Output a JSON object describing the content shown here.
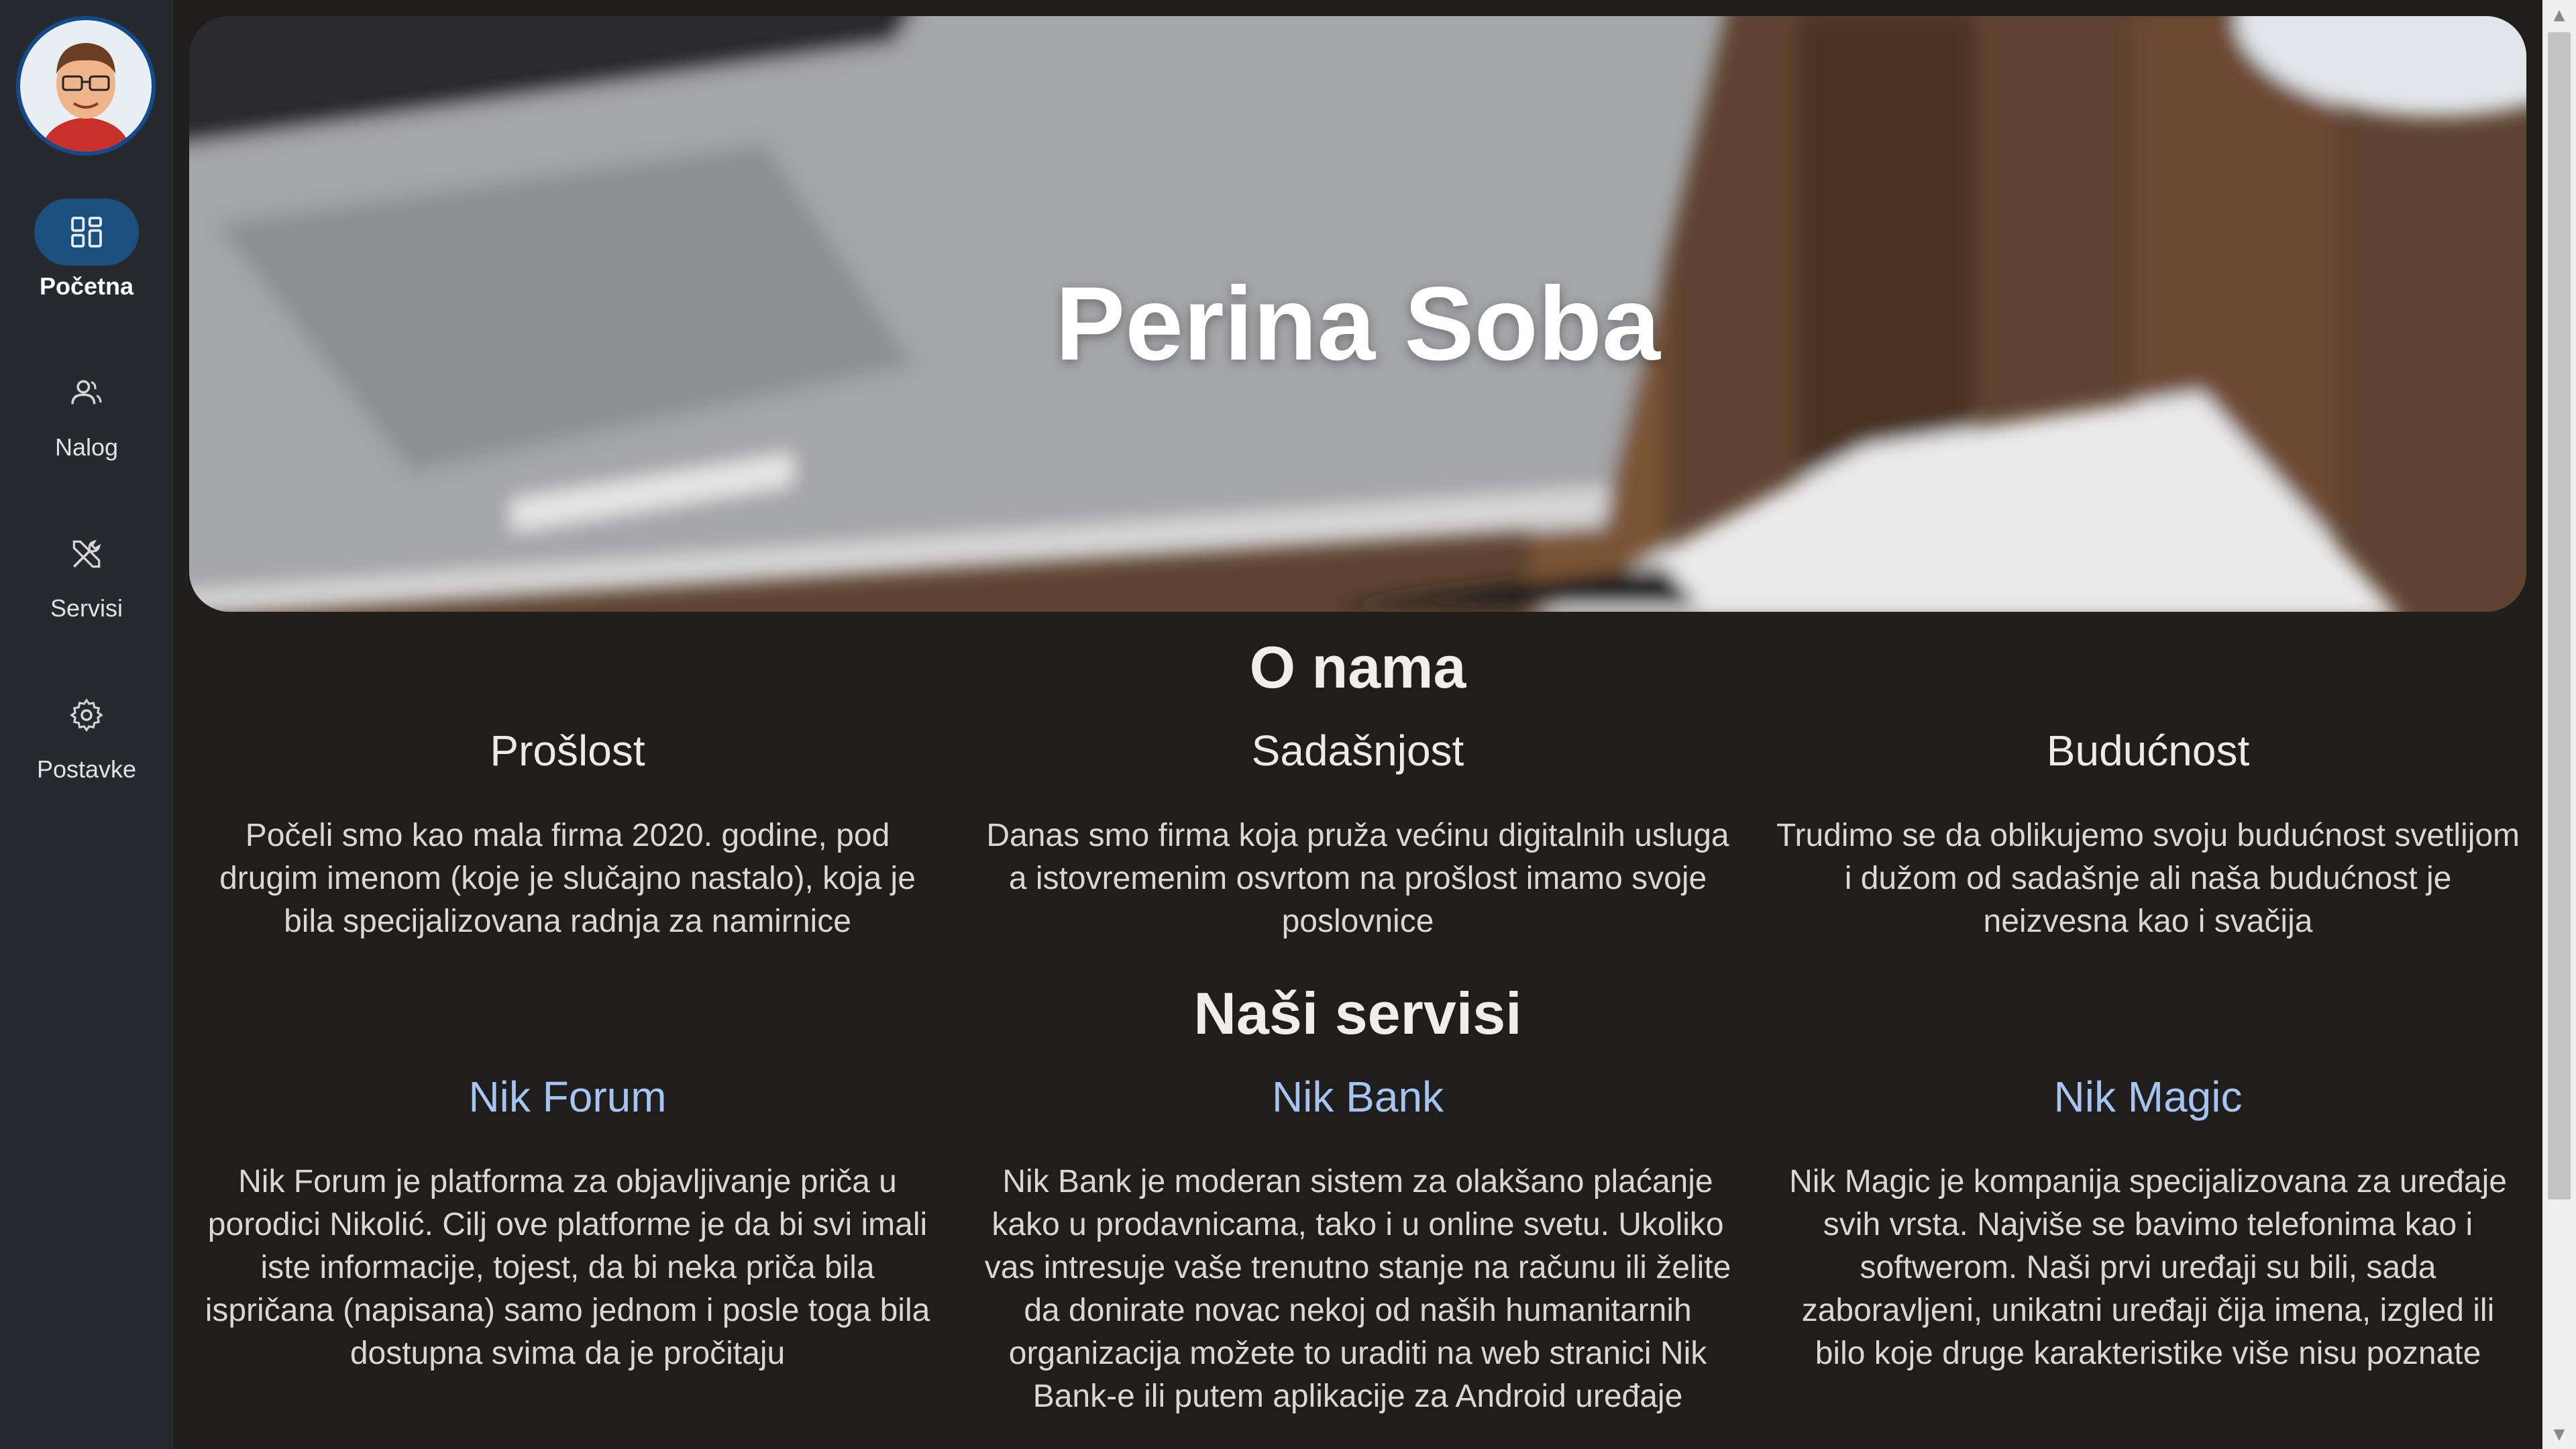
{
  "sidebar": {
    "items": [
      {
        "label": "Početna",
        "icon": "dashboard-icon",
        "active": true
      },
      {
        "label": "Nalog",
        "icon": "user-icon",
        "active": false
      },
      {
        "label": "Servisi",
        "icon": "tools-icon",
        "active": false
      },
      {
        "label": "Postavke",
        "icon": "gear-icon",
        "active": false
      }
    ]
  },
  "hero": {
    "title": "Perina Soba"
  },
  "about": {
    "title": "O nama",
    "columns": [
      {
        "heading": "Prošlost",
        "text": "Počeli smo kao mala firma 2020. godine, pod drugim imenom (koje je slučajno nastalo), koja je bila specijalizovana radnja za namirnice"
      },
      {
        "heading": "Sadašnjost",
        "text": "Danas smo firma koja pruža većinu digitalnih usluga a istovremenim osvrtom na prošlost imamo svoje poslovnice"
      },
      {
        "heading": "Budućnost",
        "text": "Trudimo se da oblikujemo svoju budućnost svetlijom i dužom od sadašnje ali naša budućnost je neizvesna kao i svačija"
      }
    ]
  },
  "services": {
    "title": "Naši servisi",
    "columns": [
      {
        "heading": "Nik Forum",
        "text": "Nik Forum je platforma za objavljivanje priča u porodici Nikolić. Cilj ove platforme je da bi svi imali iste informacije, tojest, da bi neka priča bila ispričana (napisana) samo jednom i posle toga bila dostupna svima da je pročitaju"
      },
      {
        "heading": "Nik Bank",
        "text": "Nik Bank je moderan sistem za olakšano plaćanje kako u prodavnicama, tako i u online svetu. Ukoliko vas intresuje vaše trenutno stanje na računu ili želite da donirate novac nekoj od naših humanitarnih organizacija možete to uraditi na web stranici Nik Bank-e ili putem aplikacije za Android uređaje"
      },
      {
        "heading": "Nik Magic",
        "text": "Nik Magic je kompanija specijalizovana za uređaje svih vrsta. Najviše se bavimo telefonima kao i softwerom. Naši prvi uređaji su bili, sada zaboravljeni, unikatni uređaji čija imena, izgled ili bilo koje druge karakteristike više nisu poznate"
      }
    ]
  },
  "colors": {
    "background": "#201d1d",
    "sidebar": "#262a2e",
    "active_nav": "#1a4f7e",
    "link": "#a6c4f2"
  }
}
